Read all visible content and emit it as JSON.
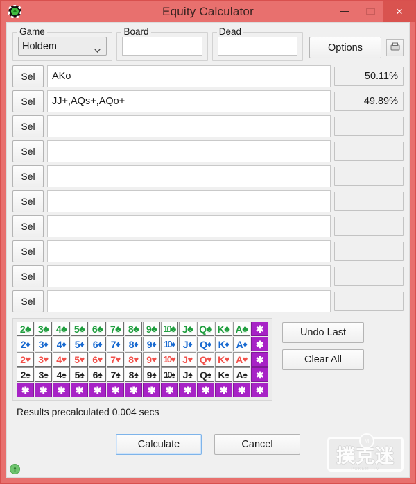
{
  "window": {
    "title": "Equity Calculator",
    "app_icon": "poker-chip-icon",
    "controls": {
      "minimize": "minimize-icon",
      "maximize": "maximize-icon",
      "close": "×"
    },
    "titlebar_color": "#e8706e",
    "close_color": "#d9534f"
  },
  "top": {
    "game": {
      "label": "Game",
      "selected": "Holdem",
      "options": [
        "Holdem"
      ]
    },
    "board": {
      "label": "Board",
      "value": "",
      "placeholder": ""
    },
    "dead": {
      "label": "Dead",
      "value": "",
      "placeholder": ""
    },
    "options_button": "Options",
    "save_button_icon": "save-disk-icon"
  },
  "hand_rows": {
    "select_label": "Sel",
    "rows": [
      {
        "hand": "AKo",
        "equity": "50.11%"
      },
      {
        "hand": "JJ+,AQs+,AQo+",
        "equity": "49.89%"
      },
      {
        "hand": "",
        "equity": ""
      },
      {
        "hand": "",
        "equity": ""
      },
      {
        "hand": "",
        "equity": ""
      },
      {
        "hand": "",
        "equity": ""
      },
      {
        "hand": "",
        "equity": ""
      },
      {
        "hand": "",
        "equity": ""
      },
      {
        "hand": "",
        "equity": ""
      },
      {
        "hand": "",
        "equity": ""
      }
    ]
  },
  "card_grid": {
    "ranks": [
      "2",
      "3",
      "4",
      "5",
      "6",
      "7",
      "8",
      "9",
      "10",
      "J",
      "Q",
      "K",
      "A"
    ],
    "suits": [
      {
        "name": "clubs",
        "symbol": "♣",
        "color": "#1f9e3e"
      },
      {
        "name": "diamonds",
        "symbol": "♦",
        "color": "#1668d0"
      },
      {
        "name": "hearts",
        "symbol": "♥",
        "color": "#f1504a"
      },
      {
        "name": "spades",
        "symbol": "♠",
        "color": "#222222"
      }
    ],
    "wildcard_symbol": "✱",
    "wildcard_color": "#a723c6",
    "wildcard_column": true,
    "wildcard_row": true
  },
  "grid_buttons": {
    "undo_last": "Undo Last",
    "clear_all": "Clear All"
  },
  "status": {
    "text": "Results precalculated 0.004 secs"
  },
  "footer": {
    "calculate": "Calculate",
    "cancel": "Cancel",
    "help_icon": "help-icon",
    "watermark": {
      "characters": "撲克迷",
      "subtitle": "PUKEMI.TV",
      "badge": "M"
    }
  }
}
